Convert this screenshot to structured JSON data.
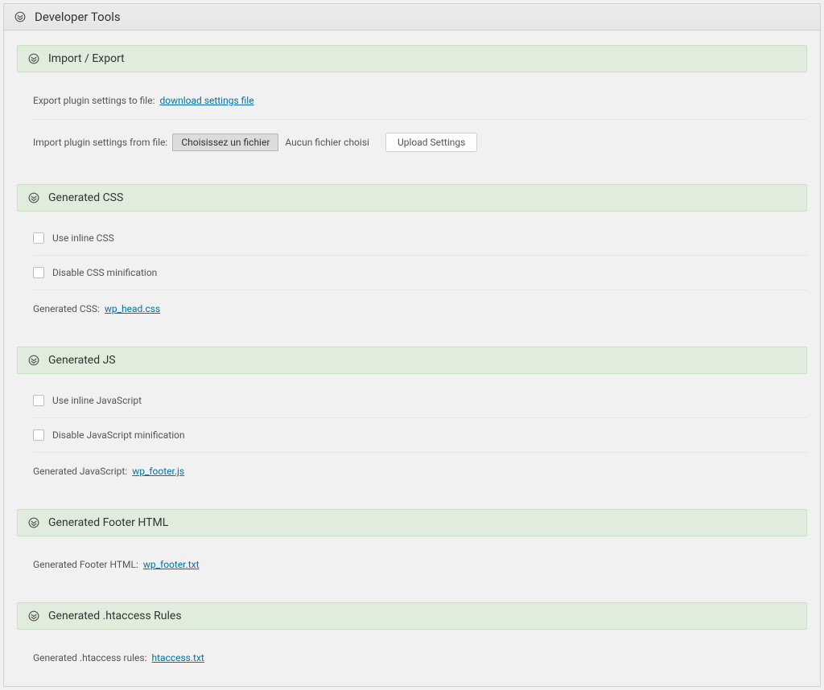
{
  "main": {
    "title": "Developer Tools"
  },
  "sections": {
    "import_export": {
      "title": "Import / Export",
      "export_label": "Export plugin settings to file: ",
      "export_link": "download settings file",
      "import_label": "Import plugin settings from file:",
      "file_button": "Choisissez un fichier",
      "file_status": "Aucun fichier choisi",
      "upload_button": "Upload Settings"
    },
    "generated_css": {
      "title": "Generated CSS",
      "inline_label": "Use inline CSS",
      "minify_label": "Disable CSS minification",
      "file_label": "Generated CSS: ",
      "file_link": "wp_head.css"
    },
    "generated_js": {
      "title": "Generated JS",
      "inline_label": "Use inline JavaScript",
      "minify_label": "Disable JavaScript minification",
      "file_label": "Generated JavaScript: ",
      "file_link": "wp_footer.js"
    },
    "generated_footer": {
      "title": "Generated Footer HTML",
      "file_label": "Generated Footer HTML: ",
      "file_link": "wp_footer.txt"
    },
    "generated_htaccess": {
      "title": "Generated .htaccess Rules",
      "file_label": "Generated .htaccess rules: ",
      "file_link": "htaccess.txt"
    }
  }
}
